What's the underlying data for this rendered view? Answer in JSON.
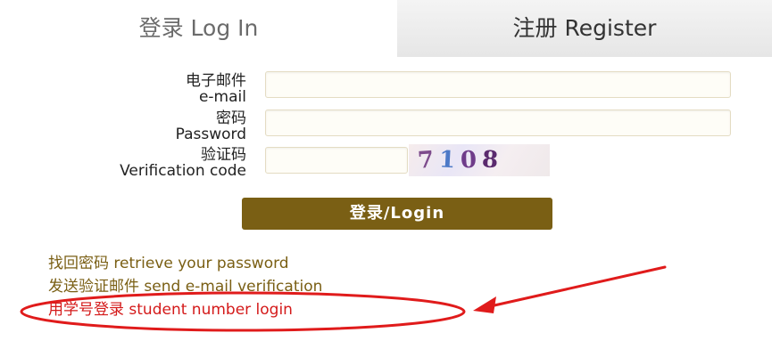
{
  "tabs": {
    "login_label": "登录 Log In",
    "register_label": "注册 Register"
  },
  "form": {
    "email_label_cn": "电子邮件",
    "email_label_en": "e-mail",
    "email_value": "",
    "password_label_cn": "密码",
    "password_label_en": "Password",
    "password_value": "",
    "verification_label_cn": "验证码",
    "verification_label_en": "Verification code",
    "verification_value": "",
    "captcha_digits": [
      "7",
      "1",
      "0",
      "8"
    ],
    "login_button_label": "登录/Login"
  },
  "links": {
    "retrieve_password": "找回密码 retrieve your password",
    "send_verification": "发送验证邮件 send e-mail verification",
    "student_number_login": "用学号登录 student number login"
  },
  "colors": {
    "accent_brown": "#7a5f14",
    "annotation_red": "#e01b1b"
  }
}
